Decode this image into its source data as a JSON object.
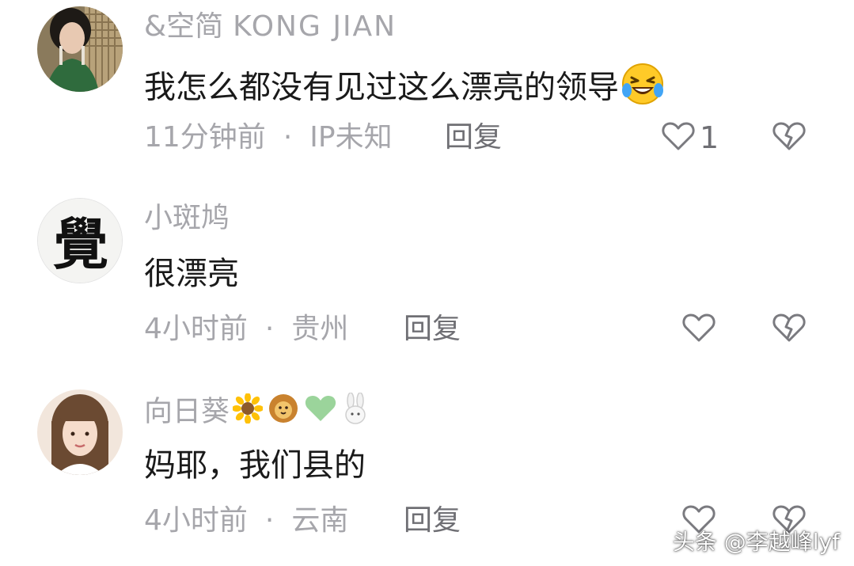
{
  "comments": [
    {
      "username_cn": "&空简",
      "username_latin": "KONG  JIAN",
      "content": "我怎么都没有见过这么漂亮的领导",
      "content_emoji": "rolling-on-floor-laughing-emoji",
      "time": "11分钟前",
      "separator": "·",
      "location": "IP未知",
      "reply_label": "回复",
      "like_count": "1"
    },
    {
      "username": "小斑鸠",
      "content": "很漂亮",
      "time": "4小时前",
      "separator": "·",
      "location": "贵州",
      "reply_label": "回复"
    },
    {
      "username": "向日葵",
      "username_emojis": [
        "sunflower-emoji",
        "lion-emoji",
        "green-heart-emoji",
        "rabbit-emoji"
      ],
      "content": "妈耶，我们县的",
      "time": "4小时前",
      "separator": "·",
      "location": "云南",
      "reply_label": "回复"
    }
  ],
  "watermark": "头条 @李越峰lyf",
  "colors": {
    "username": "#a6a6ab",
    "content": "#1a1a1a",
    "meta": "#a6a6ab",
    "action": "#6f6f74",
    "background": "#ffffff"
  }
}
